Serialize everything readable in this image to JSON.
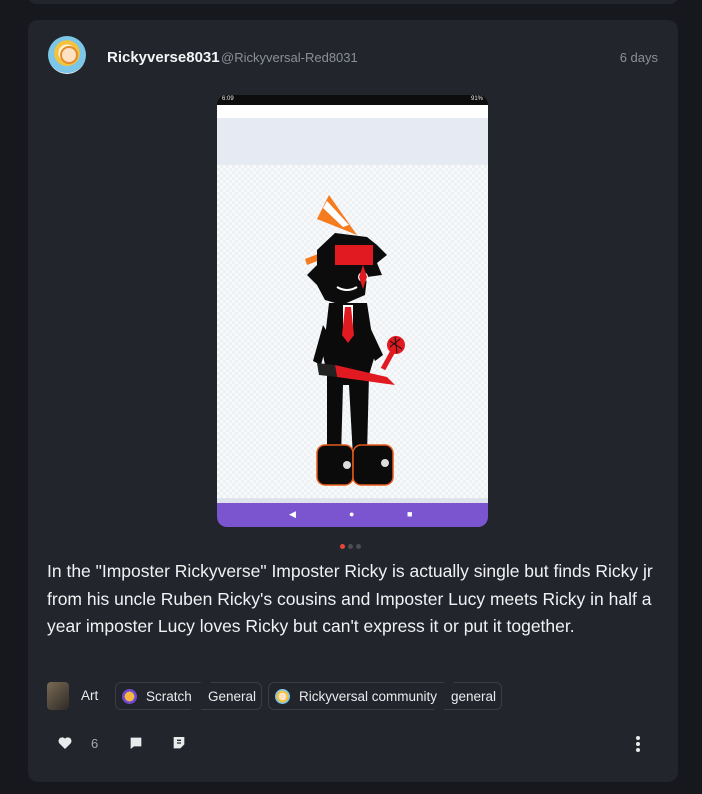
{
  "post": {
    "username": "Rickyverse8031",
    "handle": "@Rickyversal-Red8031",
    "time": "6 days",
    "body": "In the \"Imposter Rickyverse\" Imposter Ricky is actually single but finds Ricky jr from his uncle Ruben Ricky's cousins and Imposter Lucy meets Ricky in half a year imposter Lucy loves Ricky but can't express it or put it together.",
    "media": {
      "status_left": "6:09",
      "status_right": "91%",
      "nav_back": "◀",
      "nav_home": "●",
      "nav_recent": "■",
      "carousel_count": 3,
      "carousel_active": 0
    }
  },
  "tags": [
    {
      "label": "Art",
      "icon": "art-icon"
    },
    {
      "label": "Scratch",
      "sub": "General",
      "icon": "scratch-icon"
    },
    {
      "label": "Rickyversal community",
      "sub": "general",
      "icon": "community-icon"
    }
  ],
  "actions": {
    "like_count": "6",
    "like_icon": "heart-icon",
    "comment_icon": "comment-icon",
    "share_icon": "repost-icon",
    "more_icon": "more-vertical-icon"
  },
  "colors": {
    "background": "#16181d",
    "card": "#23252c",
    "nav_purple": "#7b55cf",
    "active_dot": "#e8453c"
  }
}
